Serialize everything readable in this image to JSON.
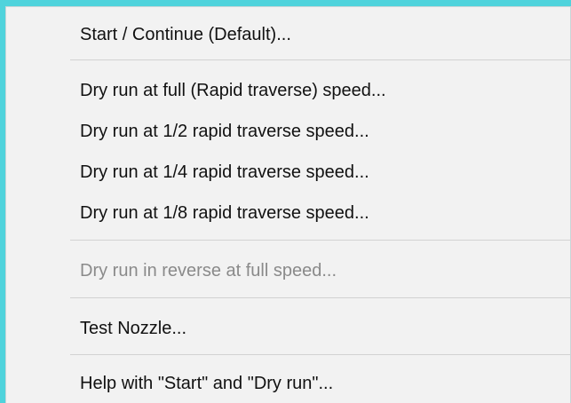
{
  "menu": {
    "items": [
      {
        "label": "Start / Continue (Default)...",
        "enabled": true
      },
      {
        "label": "Dry run at full (Rapid traverse) speed...",
        "enabled": true
      },
      {
        "label": "Dry run at 1/2 rapid traverse speed...",
        "enabled": true
      },
      {
        "label": "Dry run at 1/4 rapid traverse speed...",
        "enabled": true
      },
      {
        "label": "Dry run at 1/8 rapid traverse speed...",
        "enabled": true
      },
      {
        "label": "Dry run in reverse at full speed...",
        "enabled": false
      },
      {
        "label": "Test Nozzle...",
        "enabled": true
      },
      {
        "label": "Help with \"Start\" and \"Dry run\"...",
        "enabled": true
      }
    ]
  },
  "colors": {
    "background": "#4fd3dc",
    "menu_bg": "#f2f2f2",
    "text": "#111111",
    "disabled_text": "#8a8a8a",
    "separator": "#d2d2d2"
  }
}
